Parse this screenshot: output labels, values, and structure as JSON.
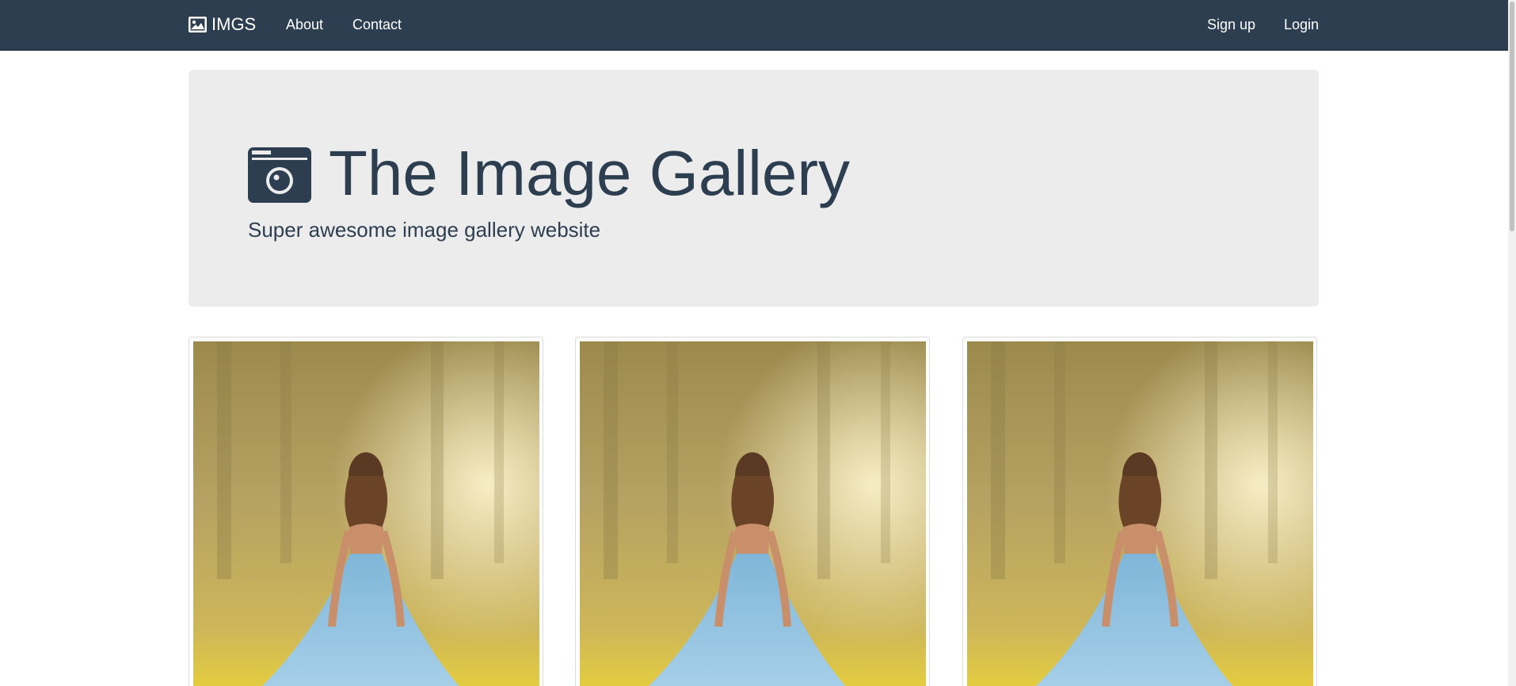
{
  "navbar": {
    "brand": {
      "label": "IMGS",
      "icon": "image-icon"
    },
    "left_links": [
      {
        "label": "About"
      },
      {
        "label": "Contact"
      }
    ],
    "right_links": [
      {
        "label": "Sign up"
      },
      {
        "label": "Login"
      }
    ]
  },
  "jumbotron": {
    "icon": "camera-icon",
    "title": "The Image Gallery",
    "subtitle": "Super awesome image gallery website"
  },
  "gallery": {
    "images": [
      {
        "alt": "woman-in-blue-dress"
      },
      {
        "alt": "woman-in-blue-dress"
      },
      {
        "alt": "woman-in-blue-dress"
      }
    ]
  },
  "colors": {
    "navbar_bg": "#2c3e50",
    "jumbotron_bg": "#ececec",
    "title_text": "#2c3e50"
  }
}
